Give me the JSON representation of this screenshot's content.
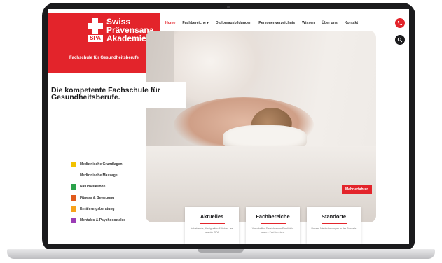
{
  "logo": {
    "mark": "SPA",
    "lines": [
      "Swiss",
      "Prävensana",
      "Akademie"
    ],
    "subtitle": "Fachschule für Gesundheitsberufe"
  },
  "nav": {
    "items": [
      "Home",
      "Fachbereiche ▾",
      "Diplomausbildungen",
      "Personenverzeichnis",
      "Wissen",
      "Über uns",
      "Kontakt"
    ],
    "active_index": 0
  },
  "icons": {
    "call": "phone-icon",
    "search": "search-icon"
  },
  "hero": {
    "headline_line1": "Die kompetente Fachschule für",
    "headline_line2": "Gesundheitsberufe.",
    "cta": "Mehr erfahren"
  },
  "categories": [
    {
      "label": "Medizinische Grundlagen",
      "color": "#f2c200"
    },
    {
      "label": "Medizinische Massage",
      "color": "#1f6fb3"
    },
    {
      "label": "Naturheilkunde",
      "color": "#2aa24a"
    },
    {
      "label": "Fitness & Bewegung",
      "color": "#e05a1c"
    },
    {
      "label": "Ernährungsberatung",
      "color": "#f7a21b"
    },
    {
      "label": "Mentales & Psychosoziales",
      "color": "#9b3cb5"
    }
  ],
  "cards": [
    {
      "title": "Aktuelles",
      "text": "Infoabende, Neuigkeiten & Aktuel- les aus der SPA"
    },
    {
      "title": "Fachbereiche",
      "text": "Verschaffen Sie sich einen Einblick in unsere Fachbereiche"
    },
    {
      "title": "Standorte",
      "text": "Unsere Niederlassungen in der Schweiz"
    }
  ],
  "colors": {
    "brand_red": "#e3242b",
    "dark": "#1b1b1d"
  }
}
